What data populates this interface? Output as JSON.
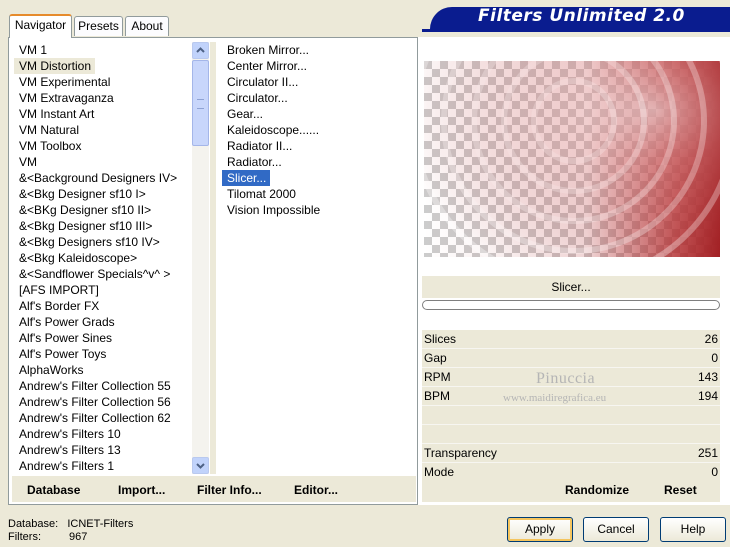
{
  "banner": {
    "title": "Filters Unlimited 2.0"
  },
  "tabs": [
    {
      "label": "Navigator"
    },
    {
      "label": "Presets"
    },
    {
      "label": "About"
    }
  ],
  "categories": [
    "VM 1",
    "VM Distortion",
    "VM Experimental",
    "VM Extravaganza",
    "VM Instant Art",
    "VM Natural",
    "VM Toolbox",
    "VM",
    "&<Background Designers IV>",
    "&<Bkg Designer sf10 I>",
    "&<BKg Designer sf10 II>",
    "&<Bkg Designer sf10 III>",
    "&<Bkg Designers sf10 IV>",
    "&<Bkg Kaleidoscope>",
    "&<Sandflower Specials^v^ >",
    "[AFS IMPORT]",
    "Alf's Border FX",
    "Alf's Power Grads",
    "Alf's Power Sines",
    "Alf's Power Toys",
    "AlphaWorks",
    "Andrew's Filter Collection 55",
    "Andrew's Filter Collection 56",
    "Andrew's Filter Collection 62",
    "Andrew's Filters 10",
    "Andrew's Filters 13",
    "Andrew's Filters 1"
  ],
  "selected_category": "VM Distortion",
  "filters": [
    "Broken Mirror...",
    "Center Mirror...",
    "Circulator II...",
    "Circulator...",
    "Gear...",
    "Kaleidoscope......",
    "Radiator II...",
    "Radiator...",
    "Slicer...",
    "Tilomat 2000",
    "Vision Impossible"
  ],
  "selected_filter": "Slicer...",
  "left_buttons": {
    "database": "Database",
    "import": "Import...",
    "filter_info": "Filter Info...",
    "editor": "Editor..."
  },
  "preview": {
    "label": "Slicer...",
    "progress": 0
  },
  "params": [
    {
      "name": "Slices",
      "value": "26"
    },
    {
      "name": "Gap",
      "value": "0"
    },
    {
      "name": "RPM",
      "value": "143"
    },
    {
      "name": "BPM",
      "value": "194"
    },
    {
      "name": "",
      "value": ""
    },
    {
      "name": "",
      "value": ""
    },
    {
      "name": "Transparency",
      "value": "251"
    },
    {
      "name": "Mode",
      "value": "0"
    }
  ],
  "right_buttons": {
    "randomize": "Randomize",
    "reset": "Reset"
  },
  "watermark": {
    "line1": "Pinuccia",
    "line2": "www.maidiregrafica.eu"
  },
  "status": {
    "database_label": "Database:",
    "database_value": "ICNET-Filters",
    "filters_label": "Filters:",
    "filters_value": "967"
  },
  "dialog_buttons": {
    "apply": "Apply",
    "cancel": "Cancel",
    "help": "Help"
  },
  "colors": {
    "banner": "#0a1c8f",
    "selection": "#316ac5",
    "preview_red": "#b0282a"
  }
}
